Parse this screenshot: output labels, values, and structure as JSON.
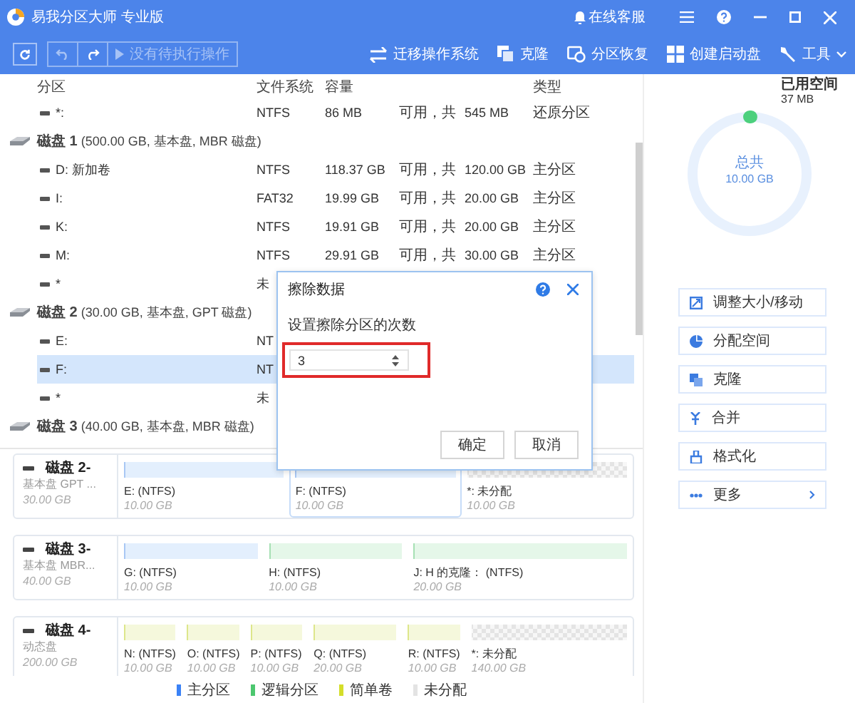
{
  "window": {
    "title": "易我分区大师 专业版",
    "support_label": "在线客服"
  },
  "toolbar": {
    "pending_label": "没有待执行操作",
    "pending_disabled": true,
    "actions": [
      {
        "label": "迁移操作系统",
        "kind": "migrate"
      },
      {
        "label": "克隆",
        "kind": "clone"
      },
      {
        "label": "分区恢复",
        "kind": "recover"
      },
      {
        "label": "创建启动盘",
        "kind": "bootdisk"
      },
      {
        "label": "工具",
        "kind": "tools"
      }
    ]
  },
  "table": {
    "columns": [
      "分区",
      "文件系统",
      "容量",
      "类型"
    ],
    "rows": [
      {
        "kind": "partition",
        "name": "*:",
        "filesystem": "NTFS",
        "free": "86 MB",
        "sep": "可用，共",
        "total": "545 MB",
        "type": "还原分区",
        "selected": false
      },
      {
        "kind": "disk",
        "name": "磁盘 1",
        "detail": "(500.00 GB, 基本盘, MBR 磁盘)"
      },
      {
        "kind": "partition",
        "name": "D: 新加卷",
        "filesystem": "NTFS",
        "free": "118.37 GB",
        "sep": "可用，共",
        "total": "120.00 GB",
        "type": "主分区",
        "selected": false
      },
      {
        "kind": "partition",
        "name": "I:",
        "filesystem": "FAT32",
        "free": "19.99 GB",
        "sep": "可用，共",
        "total": "20.00 GB",
        "type": "主分区",
        "selected": false
      },
      {
        "kind": "partition",
        "name": "K:",
        "filesystem": "NTFS",
        "free": "19.91 GB",
        "sep": "可用，共",
        "total": "20.00 GB",
        "type": "主分区",
        "selected": false
      },
      {
        "kind": "partition",
        "name": "M:",
        "filesystem": "NTFS",
        "free": "29.91 GB",
        "sep": "可用，共",
        "total": "30.00 GB",
        "type": "主分区",
        "selected": false
      },
      {
        "kind": "partition",
        "name": "*",
        "filesystem": "未",
        "selected": false
      },
      {
        "kind": "disk",
        "name": "磁盘 2",
        "detail": "(30.00 GB, 基本盘, GPT 磁盘)"
      },
      {
        "kind": "partition",
        "name": "E:",
        "filesystem": "NT",
        "selected": false
      },
      {
        "kind": "partition",
        "name": "F:",
        "filesystem": "NT",
        "selected": true
      },
      {
        "kind": "partition",
        "name": "*",
        "filesystem": "未",
        "selected": false
      },
      {
        "kind": "disk",
        "name": "磁盘 3",
        "detail": "(40.00 GB, 基本盘, MBR 磁盘)"
      }
    ]
  },
  "dialog": {
    "title": "擦除数据",
    "label": "设置擦除分区的次数",
    "value": "3",
    "highlighted": true,
    "buttons": [
      "确定",
      "取消"
    ]
  },
  "usage": {
    "used_label": "已用空间",
    "used_value": "37 MB",
    "total_label": "总共",
    "total_value": "10.00 GB",
    "level": 0.004
  },
  "actions": [
    {
      "label": "调整大小/移动",
      "kind": "resize"
    },
    {
      "label": "分配空间",
      "kind": "allocate"
    },
    {
      "label": "克隆",
      "kind": "clone"
    },
    {
      "label": "合并",
      "kind": "merge"
    },
    {
      "label": "格式化",
      "kind": "format"
    },
    {
      "label": "更多",
      "kind": "more"
    }
  ],
  "disk_map": [
    {
      "name": "磁盘 2-",
      "type": "基本盘 GPT ...",
      "size": "30.00 GB",
      "partitions": [
        {
          "label": "E: (NTFS)",
          "size": "10.00 GB",
          "kind": "primary",
          "selected": false
        },
        {
          "label": "F: (NTFS)",
          "size": "10.00 GB",
          "kind": "primary",
          "selected": true
        },
        {
          "label": "*: 未分配",
          "size": "10.00 GB",
          "kind": "unallocated",
          "selected": false
        }
      ]
    },
    {
      "name": "磁盘 3-",
      "type": "基本盘 MBR...",
      "size": "40.00 GB",
      "partitions": [
        {
          "label": "G: (NTFS)",
          "size": "10.00 GB",
          "kind": "primary",
          "selected": false
        },
        {
          "label": "H: (NTFS)",
          "size": "10.00 GB",
          "kind": "logical",
          "selected": false
        },
        {
          "label": "J: H 的克隆： (NTFS)",
          "size": "20.00 GB",
          "kind": "logical",
          "selected": false
        }
      ]
    },
    {
      "name": "磁盘 4-",
      "type": "动态盘",
      "size": "200.00 GB",
      "partitions": [
        {
          "label": "N: (NTFS)",
          "size": "10.00 GB",
          "kind": "simple",
          "selected": false
        },
        {
          "label": "O: (NTFS)",
          "size": "10.00 GB",
          "kind": "simple",
          "selected": false
        },
        {
          "label": "P: (NTFS)",
          "size": "10.00 GB",
          "kind": "simple",
          "selected": false
        },
        {
          "label": "Q: (NTFS)",
          "size": "20.00 GB",
          "kind": "simple",
          "selected": false
        },
        {
          "label": "R: (NTFS)",
          "size": "10.00 GB",
          "kind": "simple",
          "selected": false
        },
        {
          "label": "*: 未分配",
          "size": "140.00 GB",
          "kind": "unallocated",
          "selected": false
        }
      ]
    }
  ],
  "legend": [
    {
      "label": "主分区",
      "color": "#3b82f6"
    },
    {
      "label": "逻辑分区",
      "color": "#4cc76f"
    },
    {
      "label": "简单卷",
      "color": "#d4de2a"
    },
    {
      "label": "未分配",
      "color": "#e3e3e3"
    }
  ]
}
